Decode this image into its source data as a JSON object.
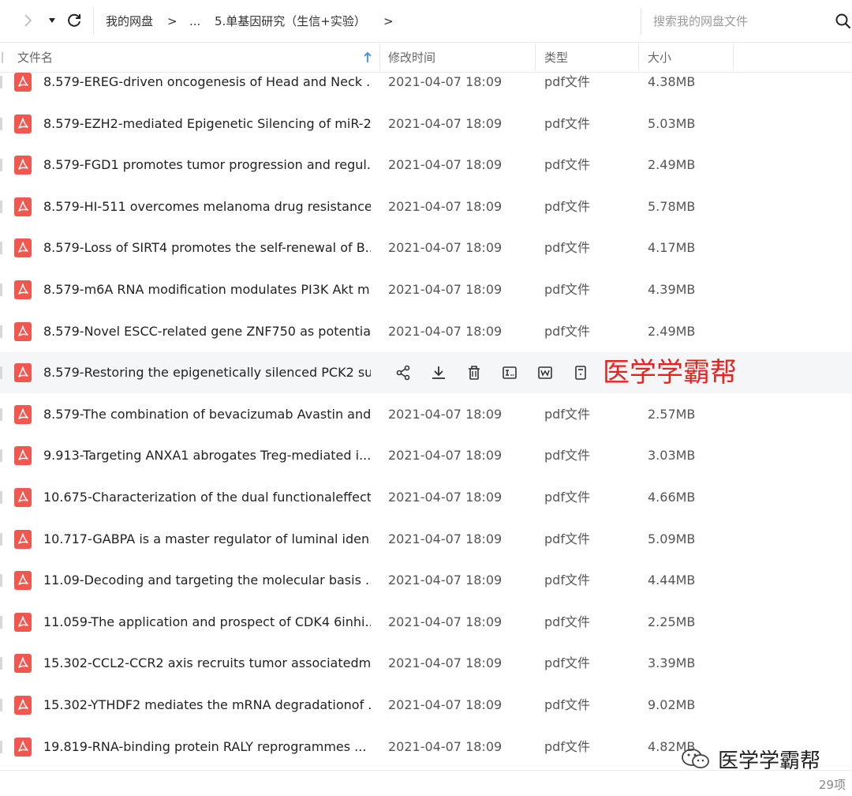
{
  "toolbar": {
    "forward_icon": "chevron-right-icon",
    "dropdown_icon": "caret-down-icon",
    "refresh_icon": "refresh-icon",
    "search_icon": "search-icon"
  },
  "breadcrumb": {
    "root": "我的网盘",
    "sep1": ">",
    "ellipsis": "...",
    "current": "5.单基因研究（生信+实验）",
    "sep2": ">"
  },
  "search": {
    "placeholder": "搜索我的网盘文件"
  },
  "columns": {
    "name": "文件名",
    "time": "修改时间",
    "type": "类型",
    "size": "大小",
    "sort_icon": "arrow-up-icon"
  },
  "rows": [
    {
      "name": "8.579-EREG-driven oncogenesis of Head and Neck ...",
      "time": "2021-04-07 18:09",
      "type": "pdf文件",
      "size": "4.38MB"
    },
    {
      "name": "8.579-EZH2-mediated Epigenetic Silencing of miR-2...",
      "time": "2021-04-07 18:09",
      "type": "pdf文件",
      "size": "5.03MB"
    },
    {
      "name": "8.579-FGD1 promotes tumor progression and regul...",
      "time": "2021-04-07 18:09",
      "type": "pdf文件",
      "size": "2.49MB"
    },
    {
      "name": "8.579-HI-511 overcomes melanoma drug resistance...",
      "time": "2021-04-07 18:09",
      "type": "pdf文件",
      "size": "5.78MB"
    },
    {
      "name": "8.579-Loss of SIRT4 promotes the self-renewal of B...",
      "time": "2021-04-07 18:09",
      "type": "pdf文件",
      "size": "4.17MB"
    },
    {
      "name": "8.579-m6A RNA modification modulates PI3K Akt m...",
      "time": "2021-04-07 18:09",
      "type": "pdf文件",
      "size": "4.39MB"
    },
    {
      "name": "8.579-Novel ESCC-related gene ZNF750 as potentia...",
      "time": "2021-04-07 18:09",
      "type": "pdf文件",
      "size": "2.49MB"
    },
    {
      "name": "8.579-Restoring the epigenetically silenced PCK2 su...",
      "hover": true
    },
    {
      "name": "8.579-The combination of bevacizumab Avastin and...",
      "time": "2021-04-07 18:09",
      "type": "pdf文件",
      "size": "2.57MB"
    },
    {
      "name": "9.913-Targeting ANXA1 abrogates Treg-mediated i...",
      "time": "2021-04-07 18:09",
      "type": "pdf文件",
      "size": "3.03MB"
    },
    {
      "name": "10.675-Characterization of the dual functionaleffect...",
      "time": "2021-04-07 18:09",
      "type": "pdf文件",
      "size": "4.66MB"
    },
    {
      "name": "10.717-GABPA is a master regulator of luminal iden...",
      "time": "2021-04-07 18:09",
      "type": "pdf文件",
      "size": "5.09MB"
    },
    {
      "name": "11.09-Decoding and targeting the molecular basis ...",
      "time": "2021-04-07 18:09",
      "type": "pdf文件",
      "size": "4.44MB"
    },
    {
      "name": "11.059-The application and prospect of CDK4 6inhi...",
      "time": "2021-04-07 18:09",
      "type": "pdf文件",
      "size": "2.25MB"
    },
    {
      "name": "15.302-CCL2-CCR2 axis recruits tumor associatedm...",
      "time": "2021-04-07 18:09",
      "type": "pdf文件",
      "size": "3.39MB"
    },
    {
      "name": "15.302-YTHDF2 mediates the mRNA degradationof ...",
      "time": "2021-04-07 18:09",
      "type": "pdf文件",
      "size": "9.02MB"
    },
    {
      "name": "19.819-RNA-binding protein RALY reprogrammes ...",
      "time": "2021-04-07 18:09",
      "type": "pdf文件",
      "size": "4.82MB"
    }
  ],
  "hover_actions": [
    "share-icon",
    "download-icon",
    "delete-icon",
    "rename-icon",
    "move-icon",
    "detail-icon"
  ],
  "watermark_red": "医学学霸帮",
  "watermark_bottom": "医学学霸帮",
  "wechat_icon": "wechat-icon",
  "footer": {
    "count": "29项"
  },
  "colors": {
    "pdf_red": "#f0574f",
    "watermark_red": "#e5241f",
    "hover_row": "#f5f6f8",
    "sort_blue": "#3a8ef6"
  }
}
